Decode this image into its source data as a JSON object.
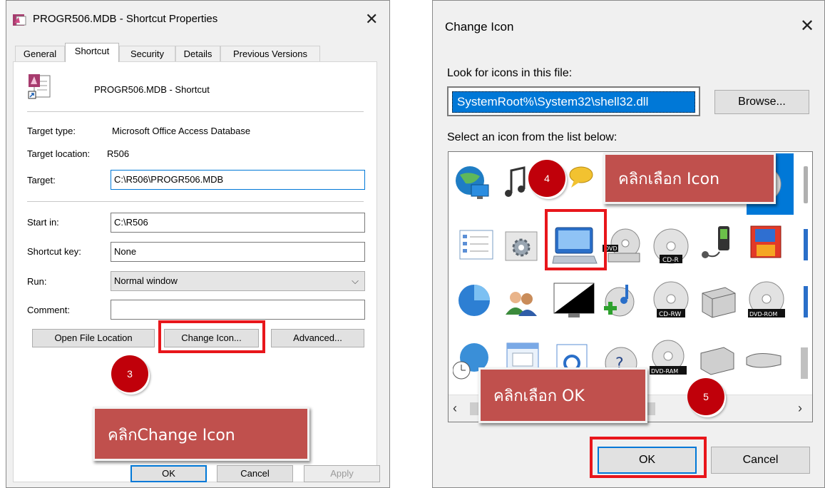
{
  "props": {
    "title": "PROGR506.MDB - Shortcut Properties",
    "tabs": [
      "General",
      "Shortcut",
      "Security",
      "Details",
      "Previous Versions"
    ],
    "shortcut_name": "PROGR506.MDB - Shortcut",
    "target_type_label": "Target type:",
    "target_type_value": "Microsoft Office Access Database",
    "target_location_label": "Target location:",
    "target_location_value": "R506",
    "target_label": "Target:",
    "target_value": "C:\\R506\\PROGR506.MDB",
    "start_in_label": "Start in:",
    "start_in_value": "C:\\R506",
    "shortcut_key_label": "Shortcut key:",
    "shortcut_key_value": "None",
    "run_label": "Run:",
    "run_value": "Normal window",
    "comment_label": "Comment:",
    "comment_value": "",
    "open_file_location": "Open File Location",
    "change_icon": "Change Icon...",
    "advanced": "Advanced...",
    "ok": "OK",
    "cancel": "Cancel",
    "apply": "Apply"
  },
  "change_icon": {
    "title": "Change Icon",
    "look_label": "Look for icons in this file:",
    "path_value": "SystemRoot%\\System32\\shell32.dll",
    "browse": "Browse...",
    "select_label": "Select an icon from the list below:",
    "ok": "OK",
    "cancel": "Cancel",
    "icon_labels": {
      "cd_r": "CD-R",
      "cd_rw": "CD-RW",
      "dvd_rom": "DVD-ROM",
      "dvd_ram": "DVD-RAM",
      "dvd": "DVD"
    }
  },
  "annotations": {
    "step3": "3",
    "step4": "4",
    "step5": "5",
    "callout_change_icon": "คลิกChange Icon",
    "callout_select_icon": "คลิกเลือก Icon",
    "callout_ok": "คลิกเลือก OK"
  },
  "colors": {
    "accent_red": "#e8161b",
    "callout": "#c0504d",
    "circle": "#c0000a",
    "selection": "#0078d7"
  }
}
